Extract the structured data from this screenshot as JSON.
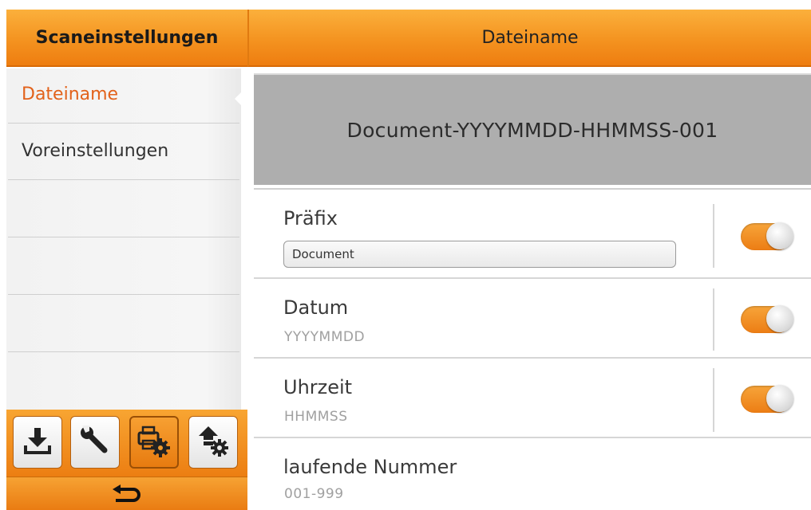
{
  "sidebar": {
    "header": "Scaneinstellungen",
    "items": [
      {
        "label": "Dateiname",
        "active": true
      },
      {
        "label": "Voreinstellungen",
        "active": false
      }
    ]
  },
  "toolbar": {
    "buttons": [
      {
        "icon": "download-icon"
      },
      {
        "icon": "wrench-icon"
      },
      {
        "icon": "scanner-settings-icon",
        "active": true
      },
      {
        "icon": "upload-settings-icon"
      }
    ],
    "back_icon": "back-arrow-icon"
  },
  "main": {
    "header": "Dateiname",
    "preview": "Document-YYYYMMDD-HHMMSS-001",
    "rows": [
      {
        "title": "Präfix",
        "value": "Document",
        "toggle": "on"
      },
      {
        "title": "Datum",
        "sub": "YYYYMMDD",
        "toggle": "on"
      },
      {
        "title": "Uhrzeit",
        "sub": "HHMMSS",
        "toggle": "on"
      },
      {
        "title": "laufende Nummer",
        "sub": "001-999"
      }
    ]
  },
  "colors": {
    "accent": "#f49320",
    "active_text": "#e2621b",
    "preview_bg": "#aeaeae"
  }
}
